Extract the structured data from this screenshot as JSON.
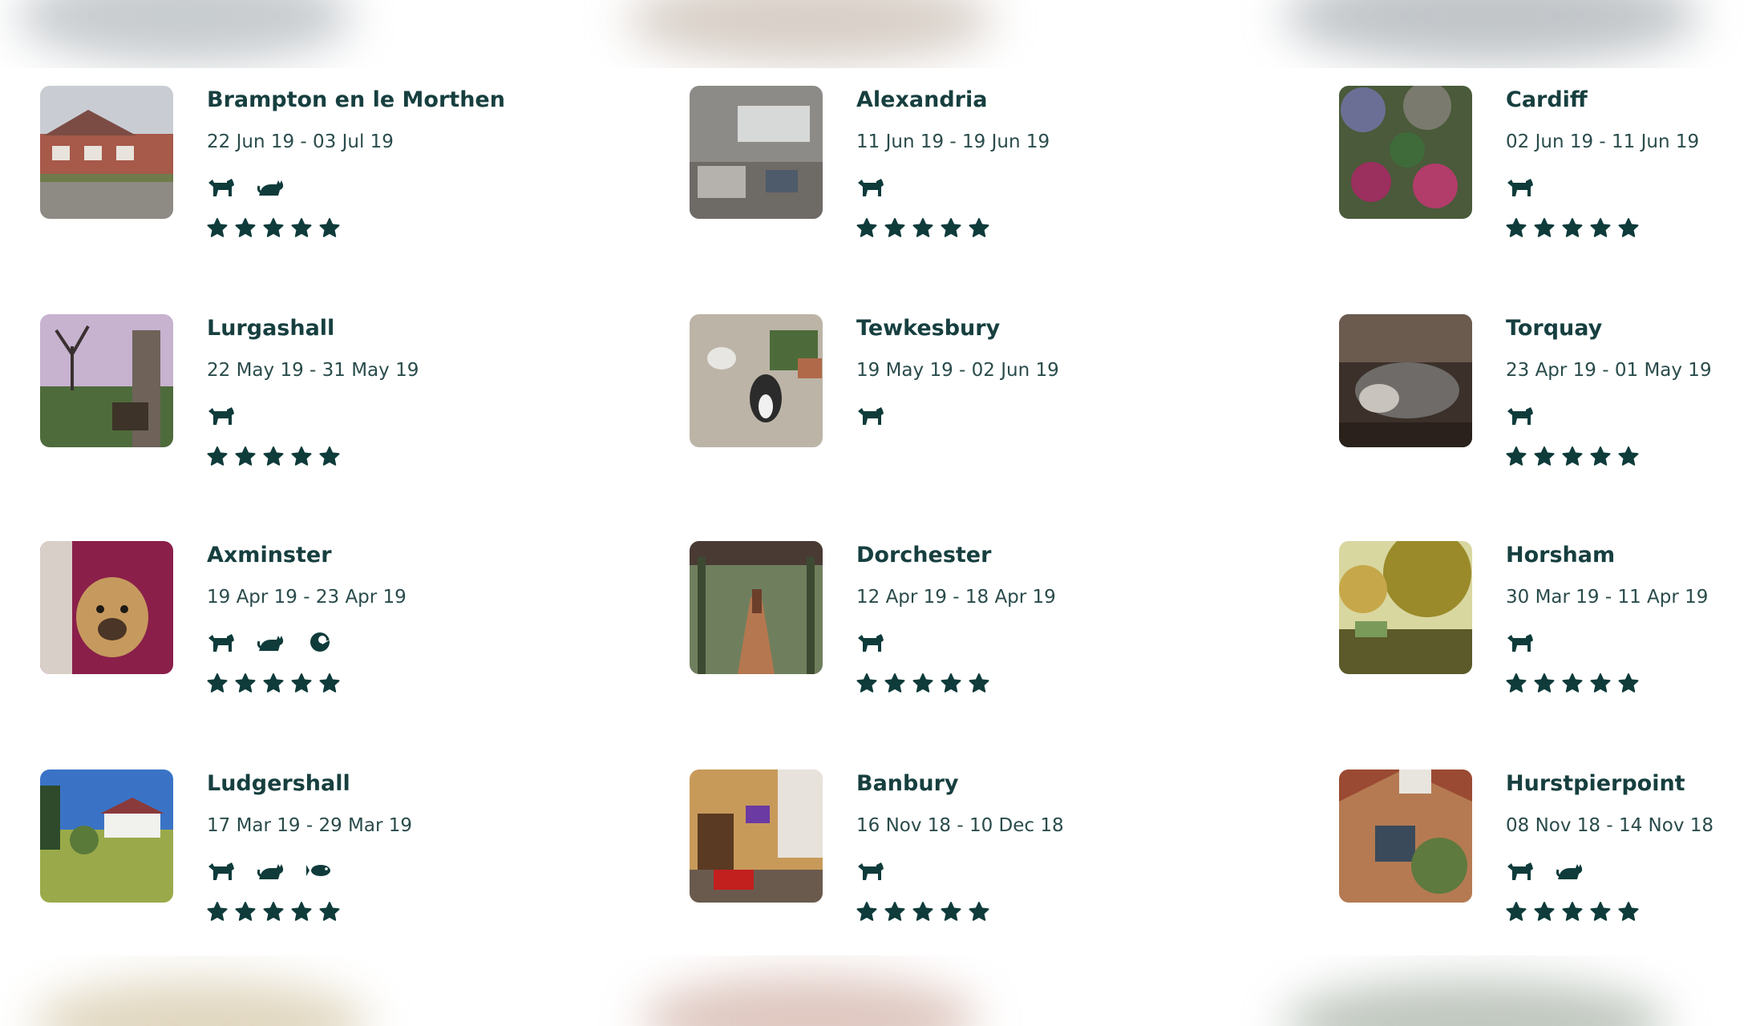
{
  "colors": {
    "accent": "#0f3b3b"
  },
  "stays": [
    {
      "location": "Brampton en le Morthen",
      "dates": "22 Jun 19 - 03 Jul 19",
      "pets": [
        "dog-icon",
        "cat-icon"
      ],
      "rating": 5
    },
    {
      "location": "Alexandria",
      "dates": "11 Jun 19 - 19 Jun 19",
      "pets": [
        "dog-icon"
      ],
      "rating": 5
    },
    {
      "location": "Cardiff",
      "dates": "02 Jun 19 - 11 Jun 19",
      "pets": [
        "dog-icon"
      ],
      "rating": 5
    },
    {
      "location": "Lurgashall",
      "dates": "22 May 19 - 31 May 19",
      "pets": [
        "dog-icon"
      ],
      "rating": 5
    },
    {
      "location": "Tewkesbury",
      "dates": "19 May 19 - 02 Jun 19",
      "pets": [
        "dog-icon"
      ],
      "rating": 0
    },
    {
      "location": "Torquay",
      "dates": "23 Apr 19 - 01 May 19",
      "pets": [
        "dog-icon"
      ],
      "rating": 5
    },
    {
      "location": "Axminster",
      "dates": "19 Apr 19 - 23 Apr 19",
      "pets": [
        "dog-icon",
        "cat-icon",
        "bird-icon"
      ],
      "rating": 5
    },
    {
      "location": "Dorchester",
      "dates": "12 Apr 19 - 18 Apr 19",
      "pets": [
        "dog-icon"
      ],
      "rating": 5
    },
    {
      "location": "Horsham",
      "dates": "30 Mar 19 - 11 Apr 19",
      "pets": [
        "dog-icon"
      ],
      "rating": 5
    },
    {
      "location": "Ludgershall",
      "dates": "17 Mar 19 - 29 Mar 19",
      "pets": [
        "dog-icon",
        "cat-icon",
        "fish-icon"
      ],
      "rating": 5
    },
    {
      "location": "Banbury",
      "dates": "16 Nov 18 - 10 Dec 18",
      "pets": [
        "dog-icon"
      ],
      "rating": 5
    },
    {
      "location": "Hurstpierpoint",
      "dates": "08 Nov 18 - 14 Nov 18",
      "pets": [
        "dog-icon",
        "cat-icon"
      ],
      "rating": 5
    }
  ]
}
